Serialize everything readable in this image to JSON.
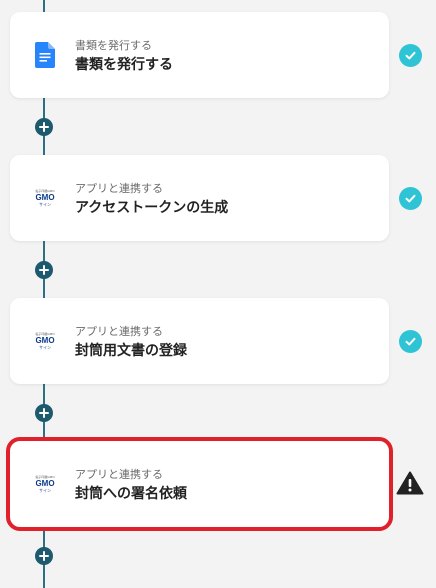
{
  "colors": {
    "accent_line": "#2d6f85",
    "check_status": "#2ec4d6",
    "highlight_border": "#e0202a",
    "warning": "#222222"
  },
  "steps": [
    {
      "subtitle": "書類を発行する",
      "title": "書類を発行する",
      "icon": "google-docs-icon",
      "status": "check"
    },
    {
      "subtitle": "アプリと連携する",
      "title": "アクセストークンの生成",
      "icon": "gmo-sign-logo",
      "status": "check"
    },
    {
      "subtitle": "アプリと連携する",
      "title": "封筒用文書の登録",
      "icon": "gmo-sign-logo",
      "status": "check"
    },
    {
      "subtitle": "アプリと連携する",
      "title": "封筒への署名依頼",
      "icon": "gmo-sign-logo",
      "status": "warning"
    }
  ],
  "logo": {
    "top_text": "電子印鑑GMO",
    "main_text": "GMO",
    "bottom_text": "サイン"
  },
  "add_step_icon": "plus-icon"
}
